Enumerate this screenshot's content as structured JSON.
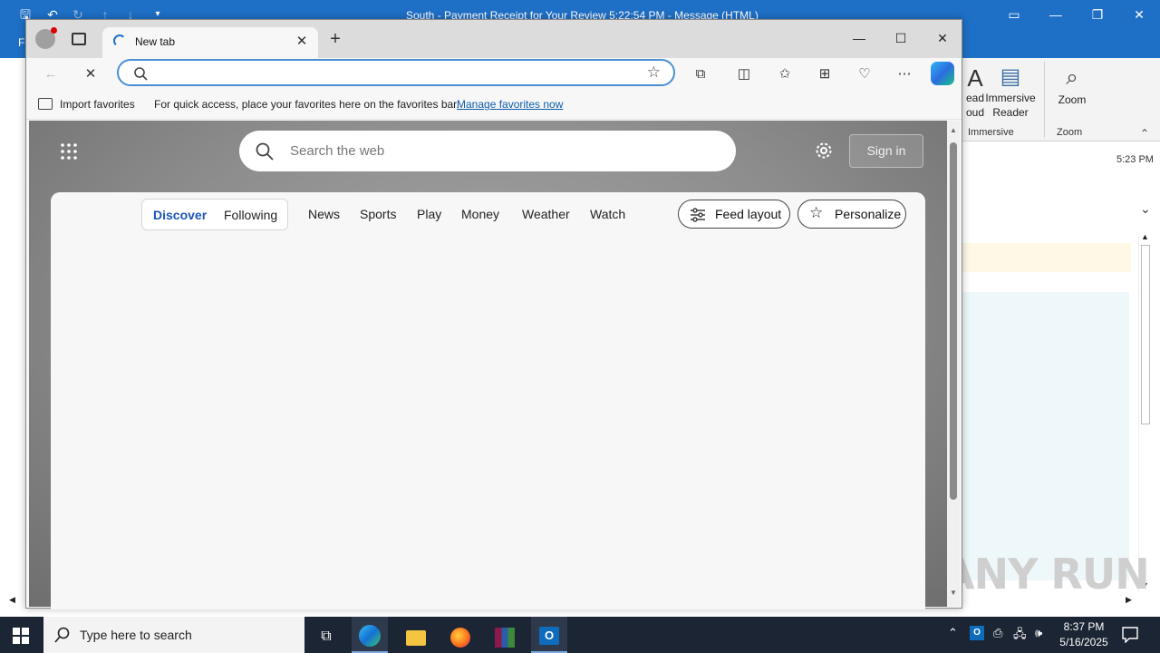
{
  "outlook": {
    "title": "South - Payment Receipt for Your Review 5:22:54 PM  -  Message (HTML)",
    "file_tab": "F",
    "ribbon": {
      "read_aloud_line1": "ead",
      "read_aloud_line2": "oud",
      "immersive_reader_line1": "Immersive",
      "immersive_reader_line2": "Reader",
      "zoom": "Zoom",
      "group_immersive": "Immersive",
      "group_zoom": "Zoom"
    },
    "time": "5:23 PM",
    "watermark": "ANY RUN"
  },
  "edge": {
    "tab_label": "New tab",
    "address_value": "",
    "favorites_bar": {
      "import_label": "Import favorites",
      "message": "For quick access, place your favorites here on the favorites bar.",
      "manage_link": "Manage favorites now"
    },
    "newtab": {
      "search_placeholder": "Search the web",
      "sign_in": "Sign in",
      "feed_tabs": [
        "Discover",
        "Following"
      ],
      "nav_items": [
        "News",
        "Sports",
        "Play",
        "Money",
        "Weather",
        "Watch"
      ],
      "feed_layout": "Feed layout",
      "personalize": "Personalize"
    }
  },
  "taskbar": {
    "search_placeholder": "Type here to search",
    "clock_time": "8:37 PM",
    "clock_date": "5/16/2025"
  },
  "colors": {
    "outlook_blue": "#1e6fc6",
    "edge_accent": "#1a56b8",
    "taskbar_bg": "#1b2533"
  }
}
